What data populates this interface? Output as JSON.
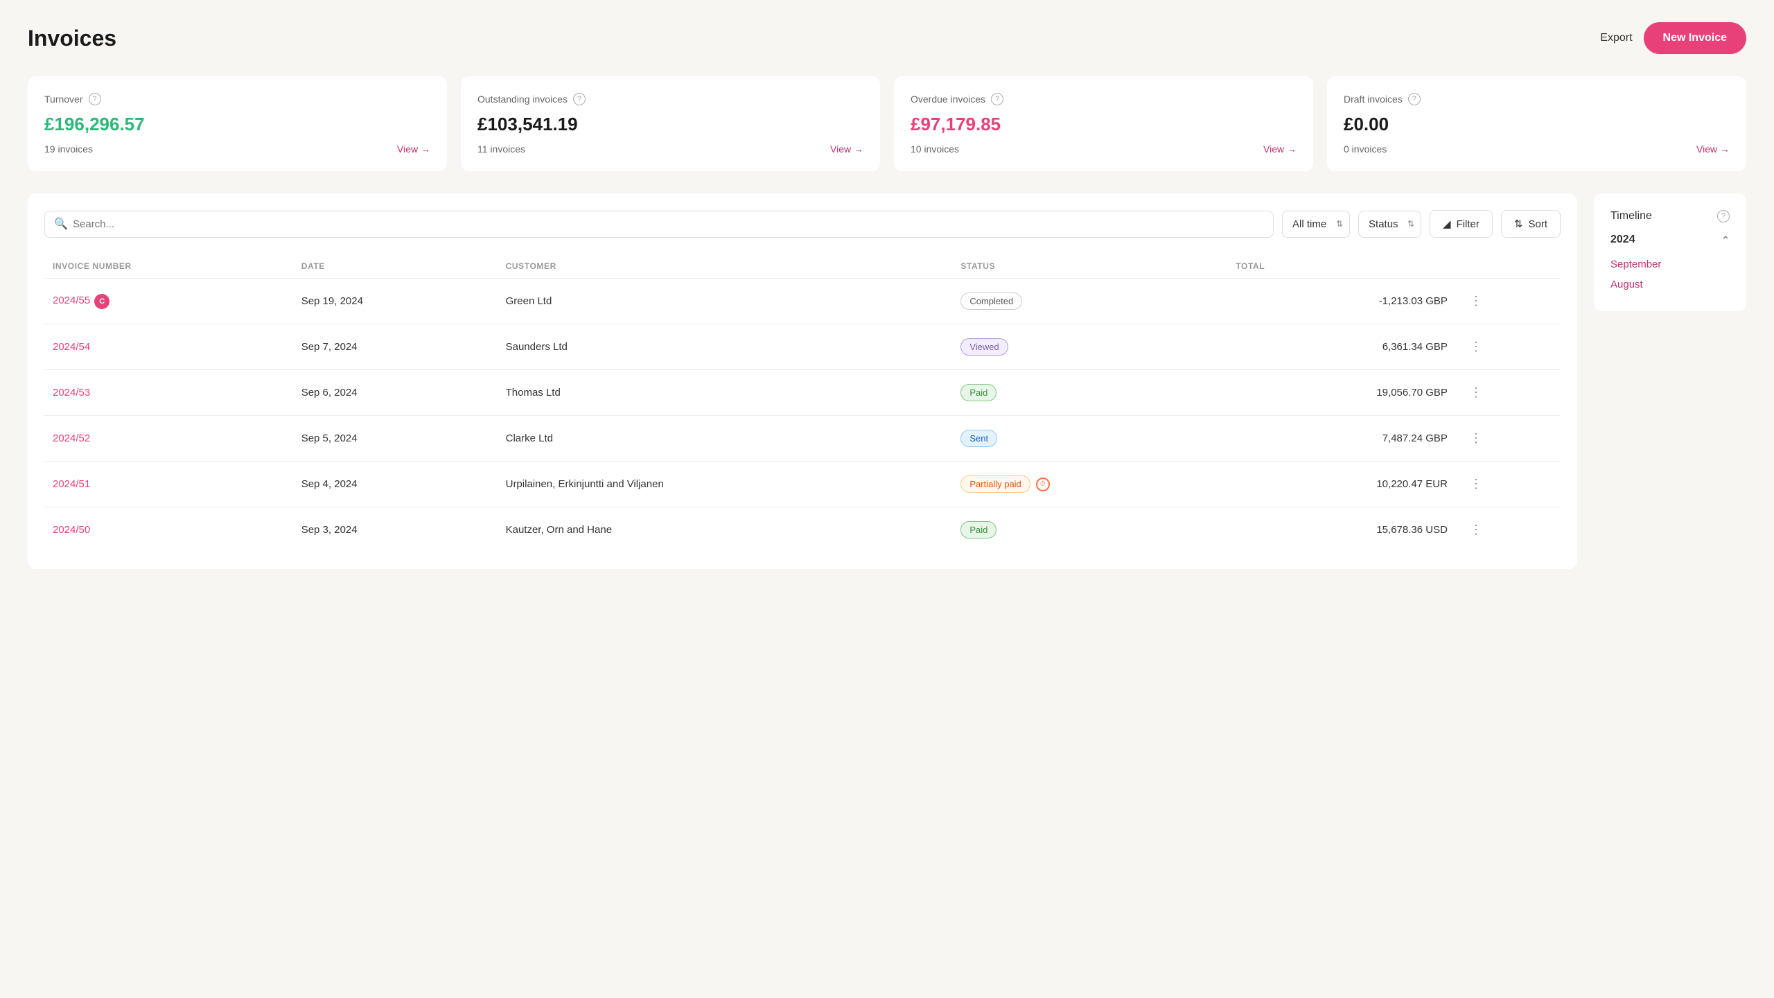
{
  "header": {
    "title": "Invoices",
    "export_label": "Export",
    "new_invoice_label": "New Invoice"
  },
  "summary_cards": [
    {
      "id": "turnover",
      "label": "Turnover",
      "amount": "£196,296.57",
      "amount_class": "green",
      "count": "19 invoices",
      "view_label": "View →"
    },
    {
      "id": "outstanding",
      "label": "Outstanding invoices",
      "amount": "£103,541.19",
      "amount_class": "normal",
      "count": "11 invoices",
      "view_label": "View →"
    },
    {
      "id": "overdue",
      "label": "Overdue invoices",
      "amount": "£97,179.85",
      "amount_class": "red",
      "count": "10 invoices",
      "view_label": "View →"
    },
    {
      "id": "draft",
      "label": "Draft invoices",
      "amount": "£0.00",
      "amount_class": "normal",
      "count": "0 invoices",
      "view_label": "View →"
    }
  ],
  "toolbar": {
    "search_placeholder": "Search...",
    "all_time_label": "All time",
    "status_label": "Status",
    "filter_label": "Filter",
    "sort_label": "Sort"
  },
  "table": {
    "columns": [
      "INVOICE NUMBER",
      "DATE",
      "CUSTOMER",
      "STATUS",
      "TOTAL"
    ],
    "rows": [
      {
        "invoice": "2024/55",
        "has_badge": true,
        "badge_text": "C",
        "date": "Sep 19, 2024",
        "customer": "Green Ltd",
        "status": "Completed",
        "status_class": "completed",
        "total": "-1,213.03 GBP",
        "has_clock": false
      },
      {
        "invoice": "2024/54",
        "has_badge": false,
        "date": "Sep 7, 2024",
        "customer": "Saunders Ltd",
        "status": "Viewed",
        "status_class": "viewed",
        "total": "6,361.34 GBP",
        "has_clock": false
      },
      {
        "invoice": "2024/53",
        "has_badge": false,
        "date": "Sep 6, 2024",
        "customer": "Thomas Ltd",
        "status": "Paid",
        "status_class": "paid",
        "total": "19,056.70 GBP",
        "has_clock": false
      },
      {
        "invoice": "2024/52",
        "has_badge": false,
        "date": "Sep 5, 2024",
        "customer": "Clarke Ltd",
        "status": "Sent",
        "status_class": "sent",
        "total": "7,487.24 GBP",
        "has_clock": false
      },
      {
        "invoice": "2024/51",
        "has_badge": false,
        "date": "Sep 4, 2024",
        "customer": "Urpilainen, Erkinjuntti and Viljanen",
        "status": "Partially paid",
        "status_class": "partial",
        "total": "10,220.47 EUR",
        "has_clock": true
      },
      {
        "invoice": "2024/50",
        "has_badge": false,
        "date": "Sep 3, 2024",
        "customer": "Kautzer, Orn and Hane",
        "status": "Paid",
        "status_class": "paid",
        "total": "15,678.36 USD",
        "has_clock": false
      }
    ]
  },
  "timeline": {
    "title": "Timeline",
    "years": [
      {
        "year": "2024",
        "expanded": true,
        "months": [
          "September",
          "August"
        ]
      }
    ]
  }
}
